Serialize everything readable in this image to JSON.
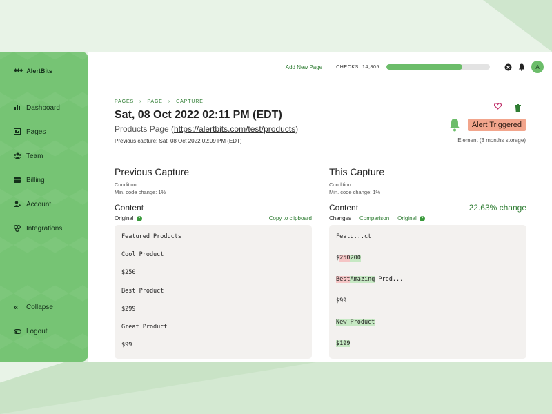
{
  "app": {
    "name": "AlertBits"
  },
  "sidebar": {
    "items": [
      {
        "label": "Dashboard",
        "icon": "bar-chart-icon"
      },
      {
        "label": "Pages",
        "icon": "pages-icon"
      },
      {
        "label": "Team",
        "icon": "team-icon"
      },
      {
        "label": "Billing",
        "icon": "card-icon"
      },
      {
        "label": "Account",
        "icon": "account-icon"
      },
      {
        "label": "Integrations",
        "icon": "integrations-icon"
      }
    ],
    "bottom": [
      {
        "label": "Collapse",
        "icon": "collapse-icon"
      },
      {
        "label": "Logout",
        "icon": "logout-icon"
      }
    ]
  },
  "topbar": {
    "add_page": "Add New Page",
    "checks_label": "CHECKS: 14,805",
    "checks_progress_pct": 73,
    "avatar_initial": "A"
  },
  "breadcrumb": [
    "PAGES",
    "PAGE",
    "CAPTURE"
  ],
  "header": {
    "title": "Sat, 08 Oct 2022 02:11 PM (EDT)",
    "page_name": "Products Page (",
    "page_url": "https://alertbits.com/test/products",
    "page_name_close": ")",
    "prev_label": "Previous capture: ",
    "prev_link": "Sat, 08 Oct 2022 02:09 PM (EDT)",
    "alert_badge": "Alert Triggered",
    "element_note": "Element (3 months storage)"
  },
  "previous": {
    "heading": "Previous Capture",
    "condition_label": "Condition:",
    "condition_value": "Min. code change: 1%",
    "content_label": "Content",
    "tab_original": "Original",
    "copy": "Copy to clipboard",
    "lines": [
      "Featured Products",
      "Cool Product",
      "$250",
      "Best Product",
      "$299",
      "Great Product",
      "$99"
    ]
  },
  "current": {
    "heading": "This Capture",
    "condition_label": "Condition:",
    "condition_value": "Min. code change: 1%",
    "content_label": "Content",
    "change_pct": "22.63% change",
    "tab_changes": "Changes",
    "tab_comparison": "Comparison",
    "tab_original": "Original",
    "lines": [
      {
        "parts": [
          {
            "t": "Featu...ct",
            "k": ""
          }
        ]
      },
      {
        "parts": [
          {
            "t": "$",
            "k": ""
          },
          {
            "t": "250",
            "k": "del"
          },
          {
            "t": "200",
            "k": "ins"
          }
        ]
      },
      {
        "parts": [
          {
            "t": "Best",
            "k": "del"
          },
          {
            "t": "Amazing",
            "k": "ins"
          },
          {
            "t": " Prod...",
            "k": ""
          }
        ]
      },
      {
        "parts": [
          {
            "t": "$99",
            "k": ""
          }
        ]
      },
      {
        "parts": [
          {
            "t": "New Product",
            "k": "ins"
          }
        ]
      },
      {
        "parts": [
          {
            "t": "$199",
            "k": "ins"
          }
        ]
      }
    ]
  },
  "colors": {
    "brand": "#76c474",
    "accent": "#2f7d33",
    "alert": "#f2a58c",
    "deleted": "#f5c5c5",
    "inserted": "#c6e8c3"
  }
}
